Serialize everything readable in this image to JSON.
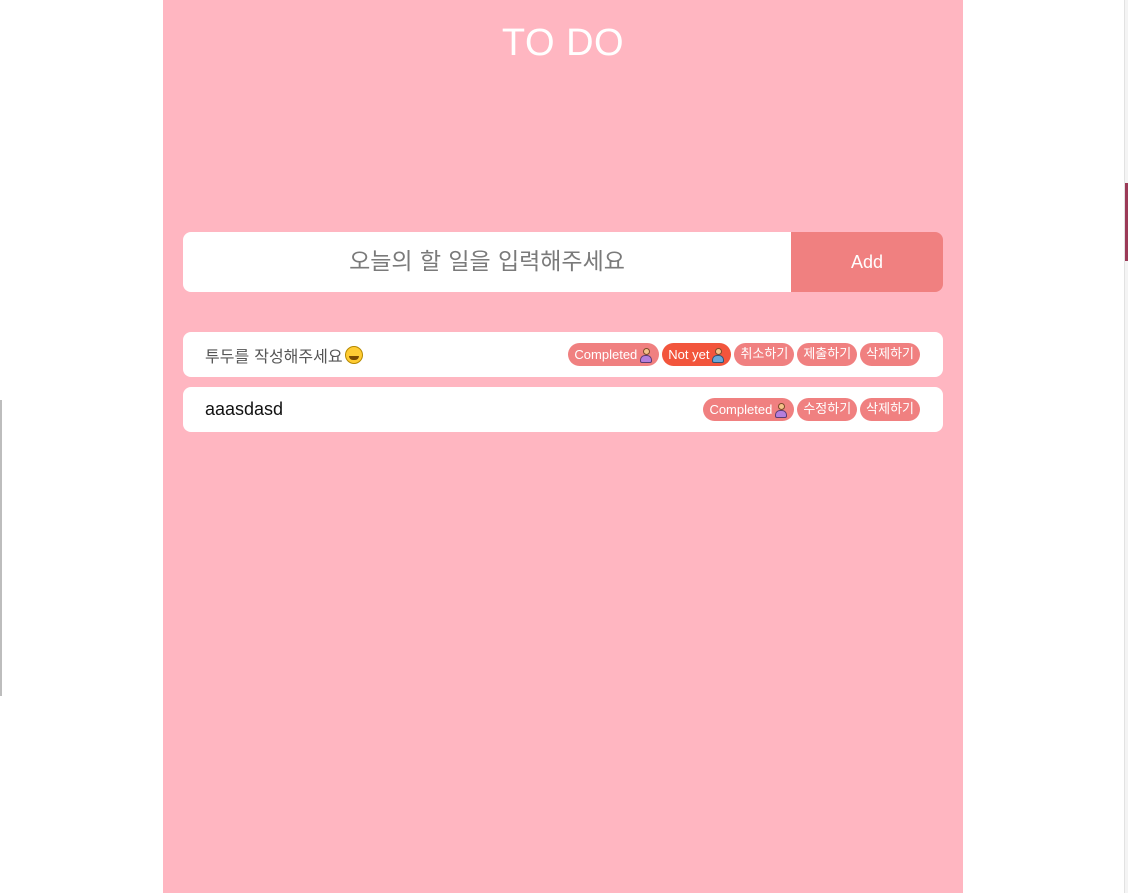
{
  "app": {
    "title": "TO DO"
  },
  "form": {
    "placeholder": "오늘의 할 일을 입력해주세요",
    "add_label": "Add"
  },
  "todos": [
    {
      "text": "투두를 작성해주세요",
      "emoji": "grinning-sweat-face-icon",
      "actions": {
        "completed": "Completed",
        "not_yet": "Not yet",
        "cancel": "취소하기",
        "submit": "제출하기",
        "delete": "삭제하기"
      }
    },
    {
      "text": "aaasdasd",
      "actions": {
        "completed": "Completed",
        "edit": "수정하기",
        "delete": "삭제하기"
      }
    }
  ],
  "colors": {
    "background": "#ffb6c1",
    "accent": "#f08080",
    "not_yet": "#f2553c",
    "text_on_accent": "#ffffff"
  }
}
